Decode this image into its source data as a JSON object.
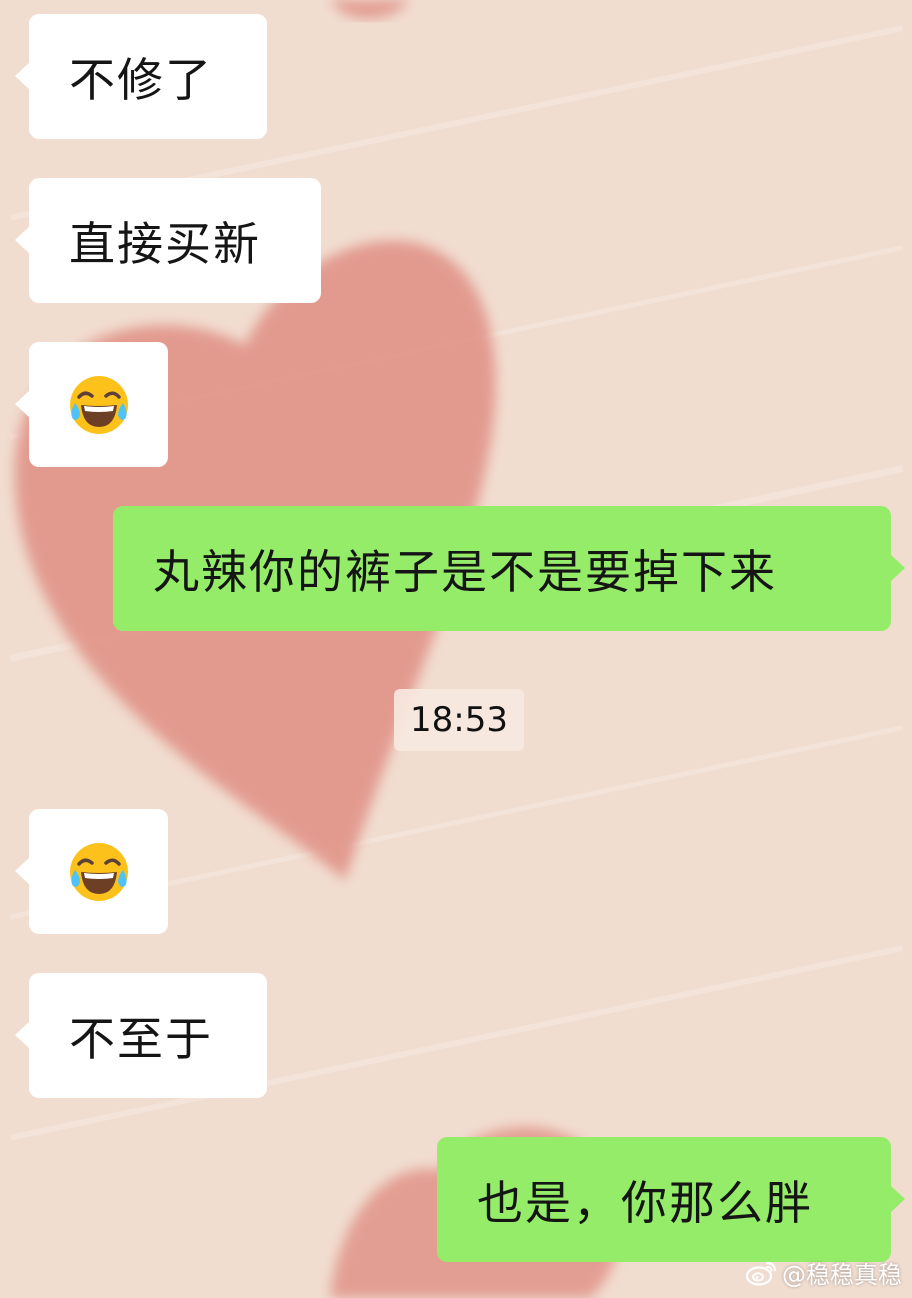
{
  "colors": {
    "background": "#f1ddd0",
    "heart": "#e08f84",
    "incoming_bubble": "#ffffff",
    "outgoing_bubble": "#95ec69"
  },
  "messages": [
    {
      "direction": "incoming",
      "type": "text",
      "text": "不修了"
    },
    {
      "direction": "incoming",
      "type": "text",
      "text": "直接买新"
    },
    {
      "direction": "incoming",
      "type": "emoji",
      "icon": "tears-of-joy-emoji"
    },
    {
      "direction": "outgoing",
      "type": "text",
      "text": "丸辣你的裤子是不是要掉下来"
    },
    {
      "direction": "incoming",
      "type": "emoji",
      "icon": "tears-of-joy-emoji"
    },
    {
      "direction": "incoming",
      "type": "text",
      "text": "不至于"
    },
    {
      "direction": "outgoing",
      "type": "text",
      "text": "也是，你那么胖"
    }
  ],
  "timestamp": "18:53",
  "watermark": {
    "icon": "weibo-logo",
    "text": "@稳稳真稳"
  }
}
